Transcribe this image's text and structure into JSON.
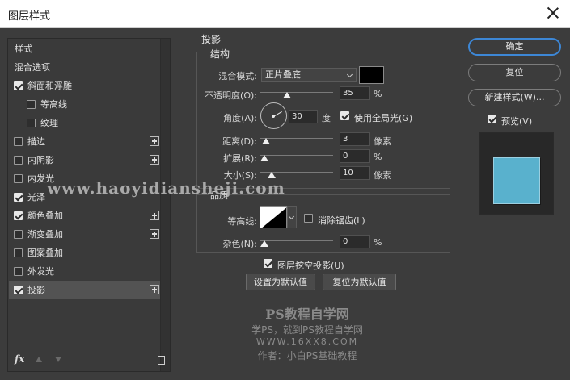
{
  "window": {
    "title": "图层样式"
  },
  "left_panel": {
    "items": [
      {
        "label": "样式",
        "checkbox": false,
        "checked": false,
        "plus": false,
        "selected": false
      },
      {
        "label": "混合选项",
        "checkbox": false,
        "checked": false,
        "plus": false,
        "selected": false
      },
      {
        "label": "斜面和浮雕",
        "checkbox": true,
        "checked": true,
        "plus": false,
        "selected": false
      },
      {
        "label": "等高线",
        "checkbox": true,
        "checked": false,
        "plus": false,
        "selected": false
      },
      {
        "label": "纹理",
        "checkbox": true,
        "checked": false,
        "plus": false,
        "selected": false
      },
      {
        "label": "描边",
        "checkbox": true,
        "checked": false,
        "plus": true,
        "selected": false
      },
      {
        "label": "内阴影",
        "checkbox": true,
        "checked": false,
        "plus": true,
        "selected": false
      },
      {
        "label": "内发光",
        "checkbox": true,
        "checked": false,
        "plus": false,
        "selected": false
      },
      {
        "label": "光泽",
        "checkbox": true,
        "checked": true,
        "plus": false,
        "selected": false
      },
      {
        "label": "颜色叠加",
        "checkbox": true,
        "checked": true,
        "plus": true,
        "selected": false
      },
      {
        "label": "渐变叠加",
        "checkbox": true,
        "checked": false,
        "plus": true,
        "selected": false
      },
      {
        "label": "图案叠加",
        "checkbox": true,
        "checked": false,
        "plus": false,
        "selected": false
      },
      {
        "label": "外发光",
        "checkbox": true,
        "checked": false,
        "plus": false,
        "selected": false
      },
      {
        "label": "投影",
        "checkbox": true,
        "checked": true,
        "plus": true,
        "selected": true
      }
    ],
    "footer": {
      "fx_label": "fx"
    }
  },
  "drop_shadow": {
    "section_title": "投影",
    "structure_title": "结构",
    "blend_mode_label": "混合模式:",
    "blend_mode_value": "正片叠底",
    "opacity_label": "不透明度(O):",
    "opacity_value": "35",
    "percent_unit": "%",
    "angle_label": "角度(A):",
    "angle_value": "30",
    "angle_unit": "度",
    "global_light_label": "使用全局光(G)",
    "global_light_checked": true,
    "distance_label": "距离(D):",
    "distance_value": "3",
    "pixel_unit": "像素",
    "spread_label": "扩展(R):",
    "spread_value": "0",
    "size_label": "大小(S):",
    "size_value": "10",
    "quality_title": "品质",
    "contour_label": "等高线:",
    "antialias_label": "消除锯齿(L)",
    "antialias_checked": false,
    "noise_label": "杂色(N):",
    "noise_value": "0",
    "knockout_label": "图层挖空投影(U)",
    "knockout_checked": true,
    "set_default_label": "设置为默认值",
    "reset_default_label": "复位为默认值"
  },
  "right_panel": {
    "ok_label": "确定",
    "reset_label": "复位",
    "new_style_label": "新建样式(W)...",
    "preview_label": "预览(V)",
    "preview_checked": true
  },
  "watermarks": {
    "url": "www.haoyidiansheji.com",
    "brand": "PS教程自学网",
    "slogan": "学PS，就到PS教程自学网",
    "site": "WWW.16XX8.COM",
    "author": "作者：小白PS基础教程"
  },
  "colors": {
    "shadow_color": "#000000",
    "preview_fill": "#59b1cd",
    "accent_border": "#3d87d6"
  }
}
